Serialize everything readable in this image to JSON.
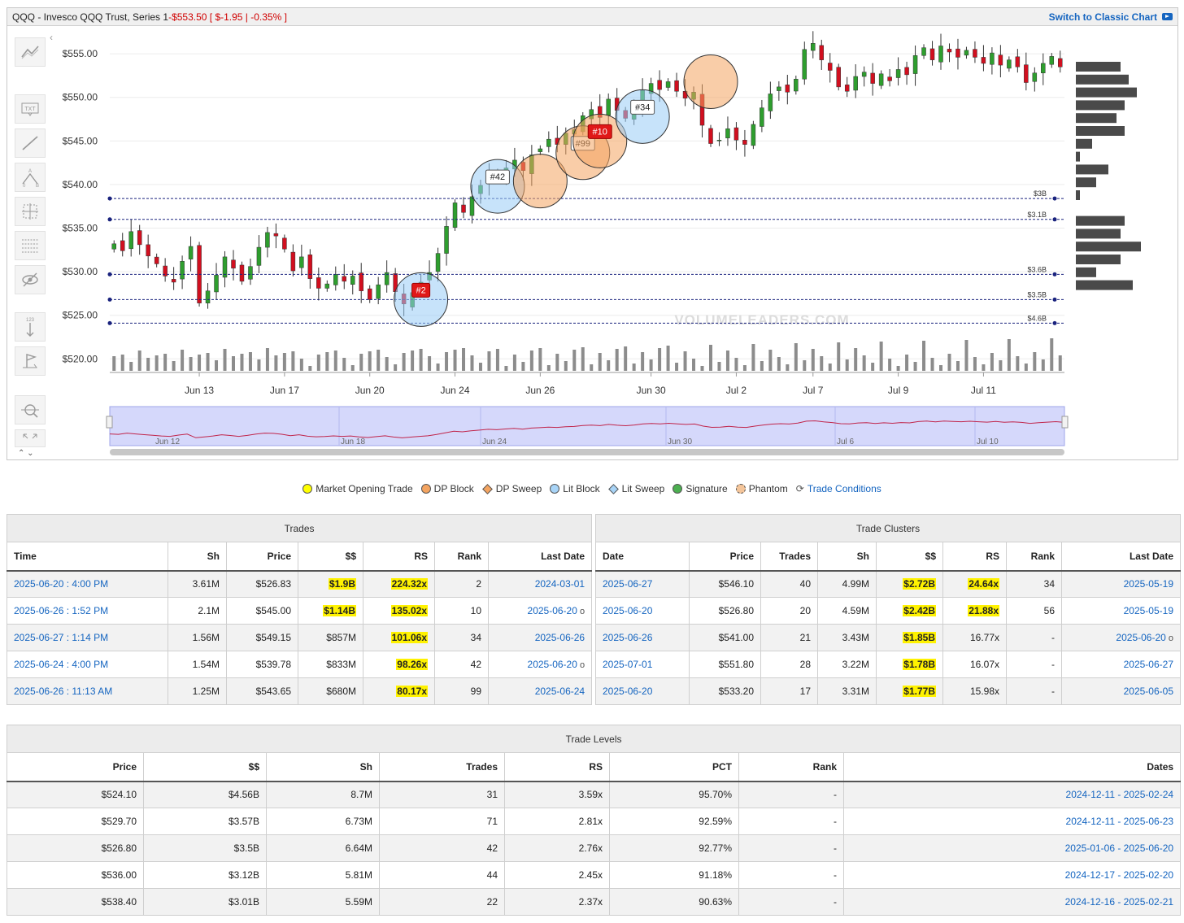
{
  "header": {
    "ticker_title": "QQQ - Invesco QQQ Trust, Series 1",
    "sep": " - ",
    "price_change": "$553.50 [ $-1.95 | -0.35% ]",
    "trail": " ]",
    "switch_label": "Switch to Classic Chart"
  },
  "toolbar": {
    "icons": [
      "trend-line-icon",
      "text-icon",
      "line-icon",
      "pattern-icon",
      "crosshair-icon",
      "fib-icon",
      "hide-icon",
      "measure-icon",
      "flag-icon",
      "zoom-icon",
      "fullscreen-icon"
    ]
  },
  "colors": {
    "up": "#2e9e2e",
    "down": "#d10f1f",
    "accent": "#1565c0",
    "dp": "#f4a460",
    "lit": "#99ccf5",
    "highlight": "#fff200"
  },
  "chart_data": {
    "type": "candlestick",
    "ylim": [
      519,
      558
    ],
    "y_ticks": [
      "$555.00",
      "$550.00",
      "$545.00",
      "$540.00",
      "$535.00",
      "$530.00",
      "$525.00",
      "$520.00"
    ],
    "y_tick_values": [
      555,
      550,
      545,
      540,
      535,
      530,
      525,
      520
    ],
    "x_ticks": [
      "Jun 13",
      "Jun 17",
      "Jun 20",
      "Jun 24",
      "Jun 26",
      "Jun 30",
      "Jul 2",
      "Jul 7",
      "Jul 9",
      "Jul 11"
    ],
    "x_tick_index": [
      10,
      20,
      30,
      40,
      50,
      63,
      73,
      82,
      92,
      102
    ],
    "closes": [
      533.2,
      532.4,
      534.6,
      533.1,
      531.8,
      530.9,
      529.5,
      528.8,
      531.2,
      532.9,
      526.4,
      527.8,
      529.6,
      531.7,
      530.4,
      528.9,
      530.6,
      532.8,
      534.5,
      534.1,
      532.6,
      530.1,
      531.7,
      529.2,
      528.1,
      528.6,
      529.7,
      528.9,
      529.5,
      527.8,
      526.8,
      528.5,
      529.9,
      527.7,
      526.3,
      527.6,
      528.8,
      529.9,
      532.1,
      535.2,
      537.9,
      536.8,
      538.6,
      539.9,
      541.3,
      540.6,
      541.9,
      542.8,
      541.6,
      543.4,
      544.1,
      545.2,
      544.6,
      545.9,
      546.3,
      547.9,
      548.6,
      547.7,
      549.8,
      548.5,
      547.6,
      548.9,
      550.8,
      551.6,
      550.9,
      551.8,
      550.7,
      549.9,
      550.6,
      546.8,
      544.7,
      545.1,
      546.4,
      545.1,
      544.6,
      546.9,
      548.8,
      550.4,
      551.2,
      550.6,
      552.1,
      555.5,
      556.2,
      554.3,
      553.1,
      551.2,
      550.7,
      552.4,
      552.9,
      551.6,
      552.7,
      551.9,
      553.2,
      552.6,
      554.8,
      555.7,
      554.3,
      555.9,
      555.2,
      554.6,
      555.4,
      554.6,
      553.9,
      555.1,
      553.7,
      554.3,
      553.5,
      551.7,
      552.8,
      553.9,
      554.7,
      553.5
    ],
    "volume_lines": [
      {
        "label": "$3B",
        "value": 538.4
      },
      {
        "label": "$3.1B",
        "value": 536.0
      },
      {
        "label": "$3.6B",
        "value": 529.7
      },
      {
        "label": "$3.5B",
        "value": 526.8
      },
      {
        "label": "$4.6B",
        "value": 524.1
      }
    ],
    "bubbles": [
      {
        "label": "#2",
        "kind": "lit",
        "index": 36,
        "value": 526.8,
        "badge": "red"
      },
      {
        "label": "#42",
        "kind": "lit",
        "index": 45,
        "value": 539.8,
        "badge": "white"
      },
      {
        "label": "",
        "kind": "dp",
        "index": 50,
        "value": 540.4
      },
      {
        "label": "#99",
        "kind": "dp",
        "index": 55,
        "value": 543.65,
        "badge": "white"
      },
      {
        "label": "#10",
        "kind": "dp",
        "index": 57,
        "value": 545.0,
        "badge": "red"
      },
      {
        "label": "#34",
        "kind": "lit",
        "index": 62,
        "value": 547.8,
        "badge": "white"
      },
      {
        "label": "",
        "kind": "dp",
        "index": 70,
        "value": 551.8
      }
    ],
    "navigator_labels": [
      "Jun 12",
      "Jun 18",
      "Jun 24",
      "Jun 30",
      "Jul 6",
      "Jul 10"
    ],
    "watermark": "VOLUMELEADERS.COM"
  },
  "legend": {
    "items": [
      {
        "label": "Market Opening Trade",
        "color": "#ffff00",
        "shape": "dot"
      },
      {
        "label": "DP Block",
        "color": "#f4a460",
        "shape": "dot"
      },
      {
        "label": "DP Sweep",
        "color": "#f4a460",
        "shape": "diamond"
      },
      {
        "label": "Lit Block",
        "color": "#a8d4f7",
        "shape": "dot"
      },
      {
        "label": "Lit Sweep",
        "color": "#a8d4f7",
        "shape": "diamond"
      },
      {
        "label": "Signature",
        "color": "#4caf50",
        "shape": "dot"
      },
      {
        "label": "Phantom",
        "color": "#f4c59a",
        "shape": "phantom"
      }
    ],
    "trade_conditions": "Trade Conditions"
  },
  "trades": {
    "title": "Trades",
    "headers": [
      "Time",
      "Sh",
      "Price",
      "$$",
      "RS",
      "Rank",
      "Last Date"
    ],
    "rows": [
      {
        "time": "2025-06-20 : 4:00 PM",
        "sh": "3.61M",
        "price": "$526.83",
        "dollars": "$1.9B",
        "rs": "224.32x",
        "rank": "2",
        "last": "2024-03-01",
        "hd": true,
        "hr": true,
        "circle": false
      },
      {
        "time": "2025-06-26 : 1:52 PM",
        "sh": "2.1M",
        "price": "$545.00",
        "dollars": "$1.14B",
        "rs": "135.02x",
        "rank": "10",
        "last": "2025-06-20",
        "hd": true,
        "hr": true,
        "circle": true
      },
      {
        "time": "2025-06-27 : 1:14 PM",
        "sh": "1.56M",
        "price": "$549.15",
        "dollars": "$857M",
        "rs": "101.06x",
        "rank": "34",
        "last": "2025-06-26",
        "hd": false,
        "hr": true,
        "circle": false
      },
      {
        "time": "2025-06-24 : 4:00 PM",
        "sh": "1.54M",
        "price": "$539.78",
        "dollars": "$833M",
        "rs": "98.26x",
        "rank": "42",
        "last": "2025-06-20",
        "hd": false,
        "hr": true,
        "circle": true
      },
      {
        "time": "2025-06-26 : 11:13 AM",
        "sh": "1.25M",
        "price": "$543.65",
        "dollars": "$680M",
        "rs": "80.17x",
        "rank": "99",
        "last": "2025-06-24",
        "hd": false,
        "hr": true,
        "circle": false
      }
    ]
  },
  "clusters": {
    "title": "Trade Clusters",
    "headers": [
      "Date",
      "Price",
      "Trades",
      "Sh",
      "$$",
      "RS",
      "Rank",
      "Last Date"
    ],
    "rows": [
      {
        "date": "2025-06-27",
        "price": "$546.10",
        "trades": "40",
        "sh": "4.99M",
        "dollars": "$2.72B",
        "rs": "24.64x",
        "rank": "34",
        "last": "2025-05-19",
        "hr": true,
        "circle": false
      },
      {
        "date": "2025-06-20",
        "price": "$526.80",
        "trades": "20",
        "sh": "4.59M",
        "dollars": "$2.42B",
        "rs": "21.88x",
        "rank": "56",
        "last": "2025-05-19",
        "hr": true,
        "circle": false
      },
      {
        "date": "2025-06-26",
        "price": "$541.00",
        "trades": "21",
        "sh": "3.43M",
        "dollars": "$1.85B",
        "rs": "16.77x",
        "rank": "-",
        "last": "2025-06-20",
        "hr": false,
        "circle": true
      },
      {
        "date": "2025-07-01",
        "price": "$551.80",
        "trades": "28",
        "sh": "3.22M",
        "dollars": "$1.78B",
        "rs": "16.07x",
        "rank": "-",
        "last": "2025-06-27",
        "hr": false,
        "circle": false
      },
      {
        "date": "2025-06-20",
        "price": "$533.20",
        "trades": "17",
        "sh": "3.31M",
        "dollars": "$1.77B",
        "rs": "15.98x",
        "rank": "-",
        "last": "2025-06-05",
        "hr": false,
        "circle": false
      }
    ]
  },
  "levels": {
    "title": "Trade Levels",
    "headers": [
      "Price",
      "$$",
      "Sh",
      "Trades",
      "RS",
      "PCT",
      "Rank",
      "Dates"
    ],
    "rows": [
      {
        "price": "$524.10",
        "dollars": "$4.56B",
        "sh": "8.7M",
        "trades": "31",
        "rs": "3.59x",
        "pct": "95.70%",
        "rank": "-",
        "dates": "2024-12-11 - 2025-02-24"
      },
      {
        "price": "$529.70",
        "dollars": "$3.57B",
        "sh": "6.73M",
        "trades": "71",
        "rs": "2.81x",
        "pct": "92.59%",
        "rank": "-",
        "dates": "2024-12-11 - 2025-06-23"
      },
      {
        "price": "$526.80",
        "dollars": "$3.5B",
        "sh": "6.64M",
        "trades": "42",
        "rs": "2.76x",
        "pct": "92.77%",
        "rank": "-",
        "dates": "2025-01-06 - 2025-06-20"
      },
      {
        "price": "$536.00",
        "dollars": "$3.12B",
        "sh": "5.81M",
        "trades": "44",
        "rs": "2.45x",
        "pct": "91.18%",
        "rank": "-",
        "dates": "2024-12-17 - 2025-02-20"
      },
      {
        "price": "$538.40",
        "dollars": "$3.01B",
        "sh": "5.59M",
        "trades": "22",
        "rs": "2.37x",
        "pct": "90.63%",
        "rank": "-",
        "dates": "2024-12-16 - 2025-02-21"
      }
    ]
  }
}
